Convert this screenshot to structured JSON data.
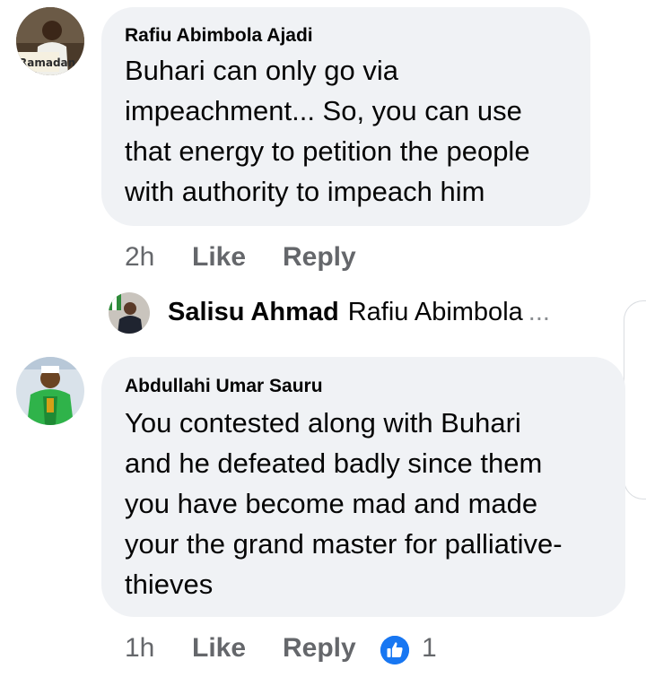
{
  "comments": [
    {
      "author": "Rafiu Abimbola Ajadi",
      "avatar_icon": "profile-photo-ramadan",
      "avatar_caption": "Ramadan",
      "lines": [
        "Buhari can only go via",
        "impeachment... So, you can use",
        "that energy to petition the people",
        "with authority to impeach him"
      ],
      "time": "2h",
      "like_label": "Like",
      "reply_label": "Reply",
      "reply_preview": {
        "author": "Salisu Ahmad",
        "text": "Rafiu Abimbola",
        "ellipsis": "..."
      }
    },
    {
      "author": "Abdullahi Umar Sauru",
      "avatar_icon": "profile-photo-green-robe",
      "lines": [
        "You contested along with Buhari",
        "and he defeated badly since them",
        "you have become mad and made",
        "your the grand master for palliative-",
        "thieves"
      ],
      "time": "1h",
      "like_label": "Like",
      "reply_label": "Reply",
      "reaction_icon": "thumbs-up-icon",
      "reaction_count": "1"
    }
  ],
  "colors": {
    "bubble": "#f0f2f5",
    "meta_text": "#65676b",
    "like_blue": "#1877f2"
  }
}
